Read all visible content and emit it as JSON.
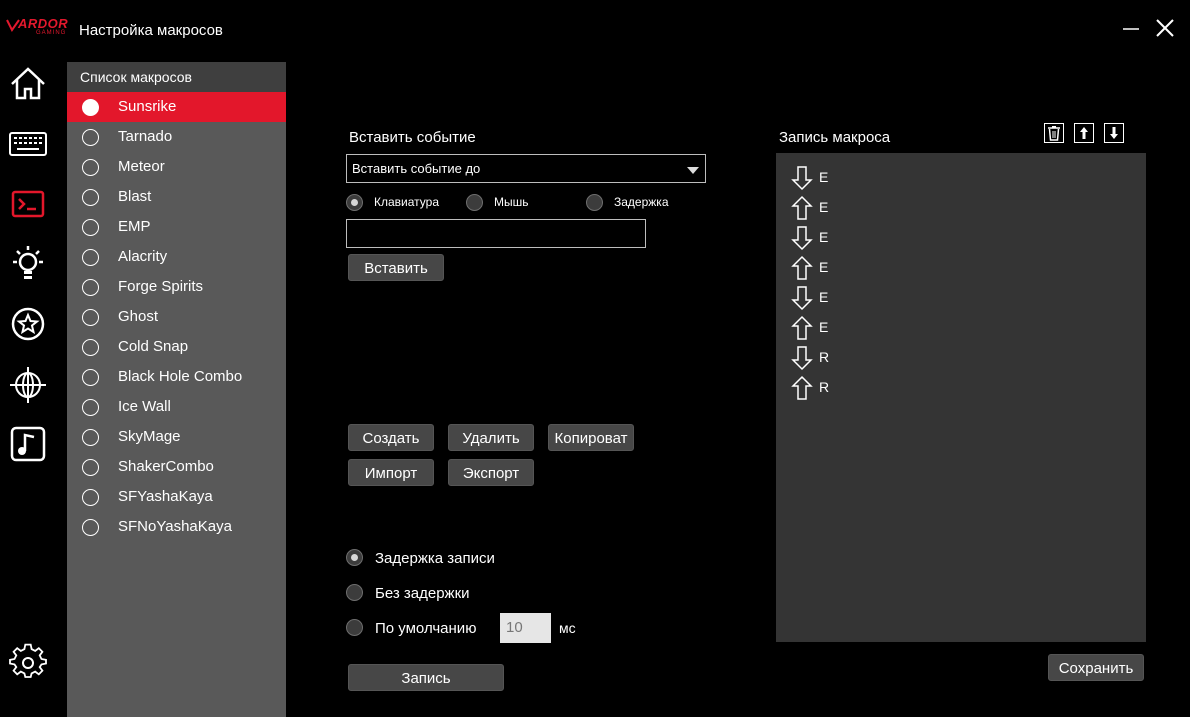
{
  "app": {
    "logo_text": "ARDOR",
    "logo_sub": "GAMING",
    "title": "Настройка макросов"
  },
  "sidebar_nav": [
    "home-icon",
    "keyboard-icon",
    "terminal-icon",
    "bulb-icon",
    "star-icon",
    "globe-icon",
    "music-icon",
    "gear-icon"
  ],
  "macro_list": {
    "header": "Список макросов",
    "selected": "Sunsrike",
    "items": [
      "Sunsrike",
      "Tarnado",
      "Meteor",
      "Blast",
      "EMP",
      "Alacrity",
      "Forge Spirits",
      "Ghost",
      "Cold Snap",
      "Black Hole Combo",
      "Ice Wall",
      "SkyMage",
      "ShakerCombo",
      "SFYashaKaya",
      "SFNoYashaKaya"
    ]
  },
  "insert_event": {
    "label": "Вставить событие",
    "select_value": "Вставить событие до",
    "type_options": [
      "Клавиатура",
      "Мышь",
      "Задержка"
    ],
    "type_selected": "Клавиатура",
    "input_value": "",
    "insert_button": "Вставить"
  },
  "actions": {
    "create": "Создать",
    "delete": "Удалить",
    "copy": "Копироват",
    "import": "Импорт",
    "export": "Экспорт"
  },
  "delay": {
    "options": [
      "Задержка записи",
      "Без задержки",
      "По умолчанию"
    ],
    "selected": "Задержка записи",
    "default_value": "10",
    "unit": "мс",
    "record_button": "Запись"
  },
  "recording": {
    "title": "Запись макроса",
    "events": [
      {
        "direction": "down",
        "key": "E"
      },
      {
        "direction": "up",
        "key": "E"
      },
      {
        "direction": "down",
        "key": "E"
      },
      {
        "direction": "up",
        "key": "E"
      },
      {
        "direction": "down",
        "key": "E"
      },
      {
        "direction": "up",
        "key": "E"
      },
      {
        "direction": "down",
        "key": "R"
      },
      {
        "direction": "up",
        "key": "R"
      }
    ],
    "save_button": "Сохранить"
  },
  "colors": {
    "accent": "#e3172b",
    "panel": "#595959",
    "record_bg": "#343434",
    "button": "#474747"
  }
}
